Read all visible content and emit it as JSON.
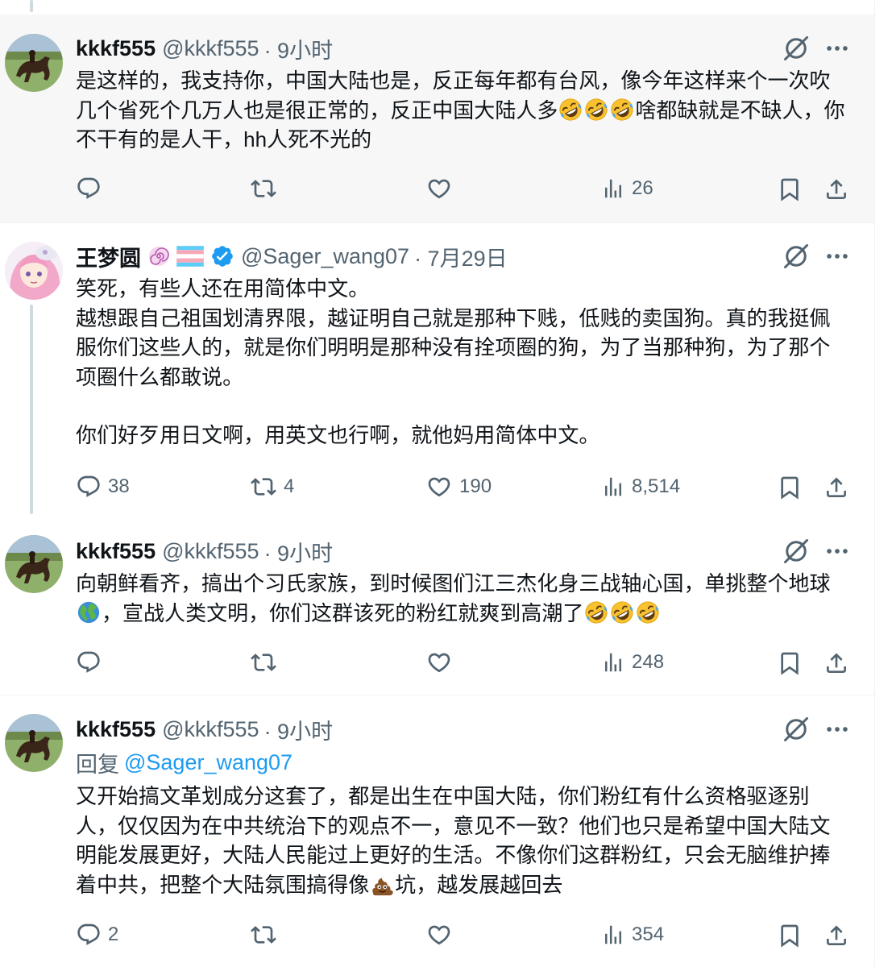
{
  "tweets": [
    {
      "name": "kkkf555",
      "handle": "@kkkf555",
      "time": "· 9小时",
      "reply_prefix": "",
      "reply_to": "",
      "paragraphs": [
        "是这样的，我支持你，中国大陆也是，反正每年都有台风，像今年这样来个一次吹几个省死个几万人也是很正常的，反正中国大陆人多🤣🤣🤣啥都缺就是不缺人，你不干有的是人干，hh人死不光的"
      ],
      "stats": {
        "replies": "",
        "reposts": "",
        "likes": "",
        "views": "26"
      }
    },
    {
      "name": "王梦圆",
      "handle": "@Sager_wang07",
      "time": "· 7月29日",
      "reply_prefix": "",
      "reply_to": "",
      "paragraphs": [
        "笑死，有些人还在用简体中文。",
        "越想跟自己祖国划清界限，越证明自己就是那种下贱，低贱的卖国狗。真的我挺佩服你们这些人的，就是你们明明是那种没有拴项圈的狗，为了当那种狗，为了那个项圈什么都敢说。",
        "你们好歹用日文啊，用英文也行啊，就他妈用简体中文。"
      ],
      "stats": {
        "replies": "38",
        "reposts": "4",
        "likes": "190",
        "views": "8,514"
      }
    },
    {
      "name": "kkkf555",
      "handle": "@kkkf555",
      "time": "· 9小时",
      "reply_prefix": "",
      "reply_to": "",
      "paragraphs": [
        "向朝鲜看齐，搞出个习氏家族，到时候图们江三杰化身三战轴心国，单挑整个地球🌍，宣战人类文明，你们这群该死的粉红就爽到高潮了🤣🤣🤣"
      ],
      "stats": {
        "replies": "",
        "reposts": "",
        "likes": "",
        "views": "248"
      }
    },
    {
      "name": "kkkf555",
      "handle": "@kkkf555",
      "time": "· 9小时",
      "reply_prefix": "回复",
      "reply_to": "@Sager_wang07",
      "paragraphs": [
        "又开始搞文革划成分这套了，都是出生在中国大陆，你们粉红有什么资格驱逐别人，仅仅因为在中共统治下的观点不一，意见不一致？他们也只是希望中国大陆文明能发展更好，大陆人民能过上更好的生活。不像你们这群粉红，只会无脑维护捧着中共，把整个大陆氛围搞得像💩坑，越发展越回去"
      ],
      "stats": {
        "replies": "2",
        "reposts": "",
        "likes": "",
        "views": "354"
      }
    }
  ],
  "icons": {
    "reply": "reply-icon",
    "repost": "repost-icon",
    "like": "like-icon",
    "views": "views-icon",
    "bookmark": "bookmark-icon",
    "share": "share-icon",
    "grok": "grok-icon",
    "more": "more-icon",
    "verified": "verified-badge-icon",
    "spiral": "spiral-emoji-icon",
    "flag": "transgender-flag-icon"
  },
  "colors": {
    "text": "#0f1419",
    "secondary": "#536471",
    "accent": "#1d9bf0",
    "highlight_bg": "#f7f7f7",
    "divider": "#eff3f4"
  }
}
